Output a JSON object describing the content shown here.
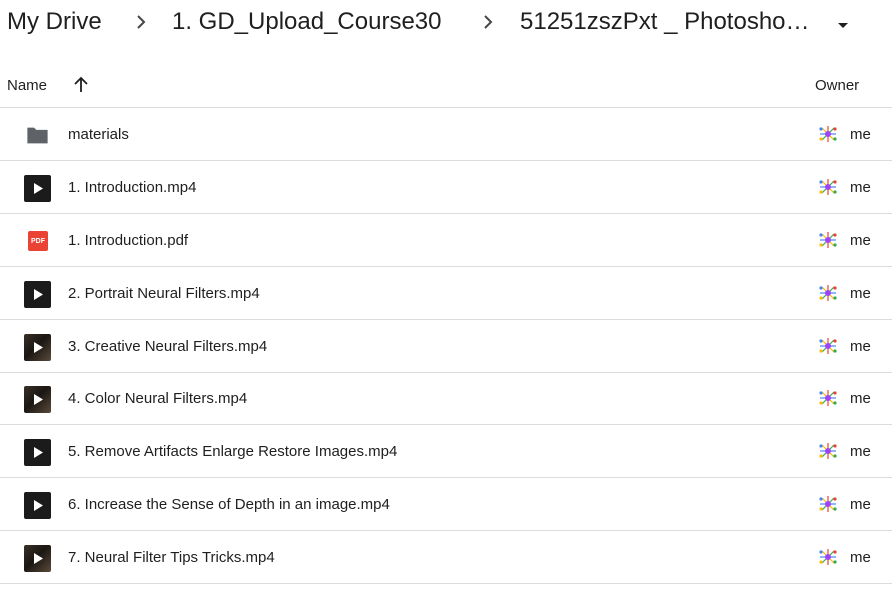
{
  "breadcrumb": {
    "items": [
      "My Drive",
      "1. GD_Upload_Course30",
      "51251zszPxt _ Photosho…"
    ]
  },
  "columns": {
    "name": "Name",
    "owner": "Owner"
  },
  "files": [
    {
      "name": "materials",
      "type": "folder",
      "owner": "me"
    },
    {
      "name": "1. Introduction.mp4",
      "type": "video",
      "owner": "me"
    },
    {
      "name": "1. Introduction.pdf",
      "type": "pdf",
      "icon_text": "PDF",
      "owner": "me"
    },
    {
      "name": "2. Portrait Neural Filters.mp4",
      "type": "video",
      "owner": "me"
    },
    {
      "name": "3. Creative Neural Filters.mp4",
      "type": "video-thumb",
      "owner": "me"
    },
    {
      "name": "4. Color Neural Filters.mp4",
      "type": "video-thumb",
      "owner": "me"
    },
    {
      "name": "5. Remove Artifacts Enlarge Restore Images.mp4",
      "type": "video",
      "owner": "me"
    },
    {
      "name": "6. Increase the Sense of Depth in an image.mp4",
      "type": "video",
      "owner": "me"
    },
    {
      "name": "7. Neural Filter Tips Tricks.mp4",
      "type": "video-thumb",
      "owner": "me"
    }
  ],
  "colors": {
    "divider": "#dadce0",
    "folder": "#5f6368",
    "pdf": "#ea4335",
    "text": "#1f1f1f"
  }
}
